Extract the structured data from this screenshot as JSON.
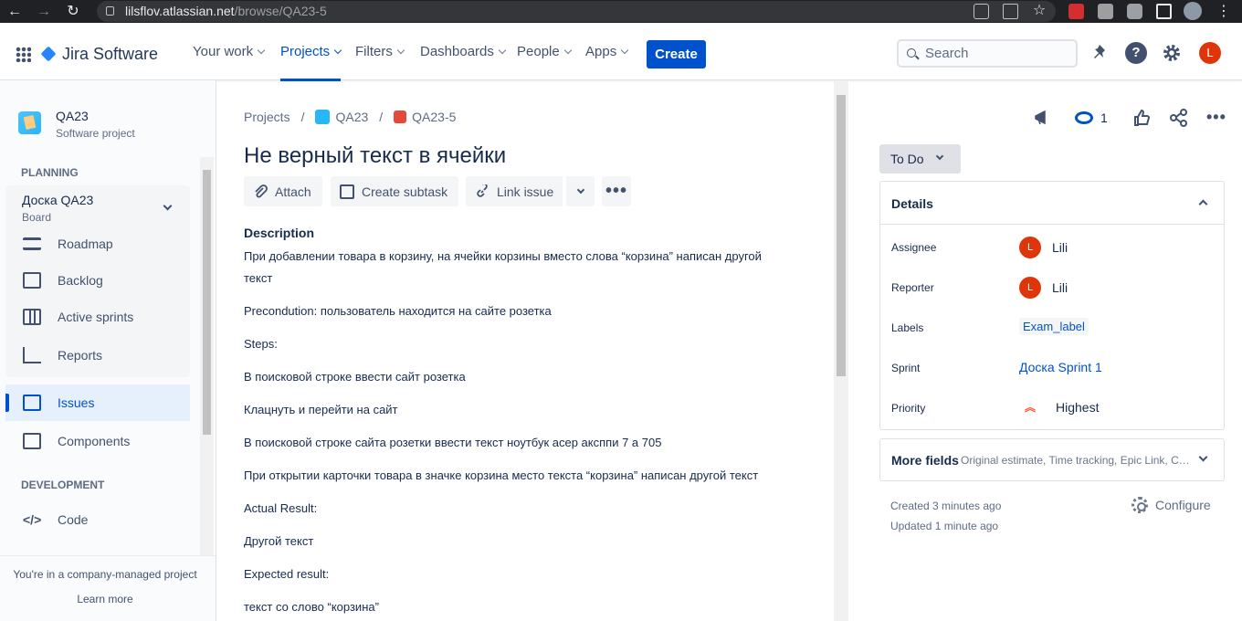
{
  "browser": {
    "url_host": "lilsflov.atlassian.net",
    "url_path": "/browse/QA23-5"
  },
  "topnav": {
    "product": "Jira Software",
    "menus": [
      "Your work",
      "Projects",
      "Filters",
      "Dashboards",
      "People",
      "Apps"
    ],
    "create_label": "Create",
    "search_placeholder": "Search",
    "avatar_letter": "L"
  },
  "sidebar": {
    "project_name": "QA23",
    "project_type": "Software project",
    "planning_header": "PLANNING",
    "board_name": "Доска QA23",
    "board_sub": "Board",
    "items": [
      {
        "label": "Roadmap"
      },
      {
        "label": "Backlog"
      },
      {
        "label": "Active sprints"
      },
      {
        "label": "Reports"
      },
      {
        "label": "Issues"
      },
      {
        "label": "Components"
      }
    ],
    "development_header": "DEVELOPMENT",
    "dev_items": [
      {
        "label": "Code"
      }
    ],
    "footer_text": "You're in a company-managed project",
    "learn_more": "Learn more"
  },
  "issue": {
    "breadcrumb": [
      "Projects",
      "QA23",
      "QA23-5"
    ],
    "title": "Не верный текст в ячейки",
    "actions": [
      "Attach",
      "Create subtask",
      "Link issue"
    ],
    "description_header": "Description",
    "description": [
      "При добавлении товара в корзину, на ячейки корзины вместо слова “корзина” написан другой текст",
      "Precondution: пользователь находится на сайте розетка",
      "Steps:",
      "В поисковой строке ввести сайт розетка",
      "Клацнуть и перейти на сайт",
      "В поисковой строке сайта розетки ввести текст ноутбук асер аксппи 7 а 705",
      "При открытии карточки товара в значке корзина место текста “корзина” написан другой текст",
      "Actual Result:",
      "Другой текст",
      "Expected result:",
      "текст со слово “корзина”"
    ]
  },
  "right_panel": {
    "watchers_count": "1",
    "status": "To Do",
    "details_header": "Details",
    "fields": [
      {
        "label": "Assignee",
        "value": "Lili",
        "avatar": "L"
      },
      {
        "label": "Reporter",
        "value": "Lili",
        "avatar": "L"
      },
      {
        "label": "Labels",
        "value": "Exam_label"
      },
      {
        "label": "Sprint",
        "value": "Доска Sprint 1"
      },
      {
        "label": "Priority",
        "value": "Highest"
      }
    ],
    "more_fields": "More fields",
    "more_fields_sub": "Original estimate, Time tracking, Epic Link, Components",
    "created": "Created 3 minutes ago",
    "updated": "Updated 1 minute ago",
    "configure": "Configure"
  },
  "colors": {
    "brand": "#0052CC",
    "avatar": "#DE350B",
    "priority_highest": "#FF5630"
  }
}
